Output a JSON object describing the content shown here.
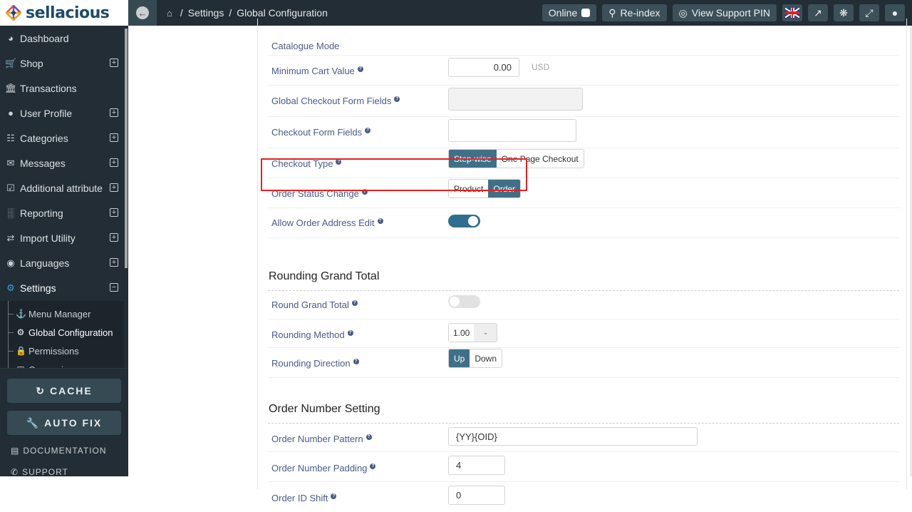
{
  "app": {
    "brand": "sellacious"
  },
  "header": {
    "breadcrumb": [
      "Settings",
      "Global Configuration"
    ],
    "online_label": "Online",
    "reindex_label": "Re-index",
    "support_pin_label": "View Support PIN"
  },
  "sidebar": {
    "items": [
      {
        "label": "Dashboard",
        "icon": "dashboard-icon",
        "expandable": false
      },
      {
        "label": "Shop",
        "icon": "cart-icon",
        "expandable": true
      },
      {
        "label": "Transactions",
        "icon": "bank-icon",
        "expandable": false
      },
      {
        "label": "User Profile",
        "icon": "user-icon",
        "expandable": true
      },
      {
        "label": "Categories",
        "icon": "sitemap-icon",
        "expandable": true
      },
      {
        "label": "Messages",
        "icon": "envelope-icon",
        "expandable": true
      },
      {
        "label": "Additional attribute",
        "icon": "checkbox-icon",
        "expandable": true
      },
      {
        "label": "Reporting",
        "icon": "bar-chart-icon",
        "expandable": true
      },
      {
        "label": "Import Utility",
        "icon": "exchange-icon",
        "expandable": true
      },
      {
        "label": "Languages",
        "icon": "globe-icon",
        "expandable": true
      },
      {
        "label": "Settings",
        "icon": "gear-icon",
        "expandable": true,
        "expanded": true
      }
    ],
    "submenu": [
      {
        "label": "Menu Manager",
        "icon": "anchor-icon"
      },
      {
        "label": "Global Configuration",
        "icon": "gears-icon",
        "active": true
      },
      {
        "label": "Permissions",
        "icon": "lock-icon"
      },
      {
        "label": "Currencies",
        "icon": "money-icon"
      }
    ],
    "cache_label": "CACHE",
    "autofix_label": "AUTO FIX",
    "documentation_label": "DOCUMENTATION",
    "support_label": "SUPPORT"
  },
  "form": {
    "partial_top_label": "Catalogue Mode",
    "min_cart": {
      "label": "Minimum Cart Value",
      "value": "0.00",
      "currency": "USD"
    },
    "global_checkout_fields": {
      "label": "Global Checkout Form Fields",
      "value": ""
    },
    "checkout_fields": {
      "label": "Checkout Form Fields",
      "value": ""
    },
    "checkout_type": {
      "label": "Checkout Type",
      "options": [
        "Step-wise",
        "One Page Checkout"
      ],
      "selected": "Step-wise"
    },
    "order_status_change": {
      "label": "Order Status Change",
      "options": [
        "Product",
        "Order"
      ],
      "selected": "Order"
    },
    "allow_address_edit": {
      "label": "Allow Order Address Edit",
      "on": true
    },
    "rounding_section": "Rounding Grand Total",
    "round_grand_total": {
      "label": "Round Grand Total",
      "on": false
    },
    "rounding_method": {
      "label": "Rounding Method",
      "value": "1.00"
    },
    "rounding_direction": {
      "label": "Rounding Direction",
      "options": [
        "Up",
        "Down"
      ],
      "selected": "Up"
    },
    "order_number_section": "Order Number Setting",
    "order_number_pattern": {
      "label": "Order Number Pattern",
      "value": "{YY}{OID}"
    },
    "order_number_padding": {
      "label": "Order Number Padding",
      "value": "4"
    },
    "order_id_shift": {
      "label": "Order ID Shift",
      "value": "0"
    }
  },
  "colors": {
    "accent": "#3f7088",
    "sidebar_bg": "#222d35",
    "highlight": "#e8201f",
    "label": "#4a5a8a"
  }
}
